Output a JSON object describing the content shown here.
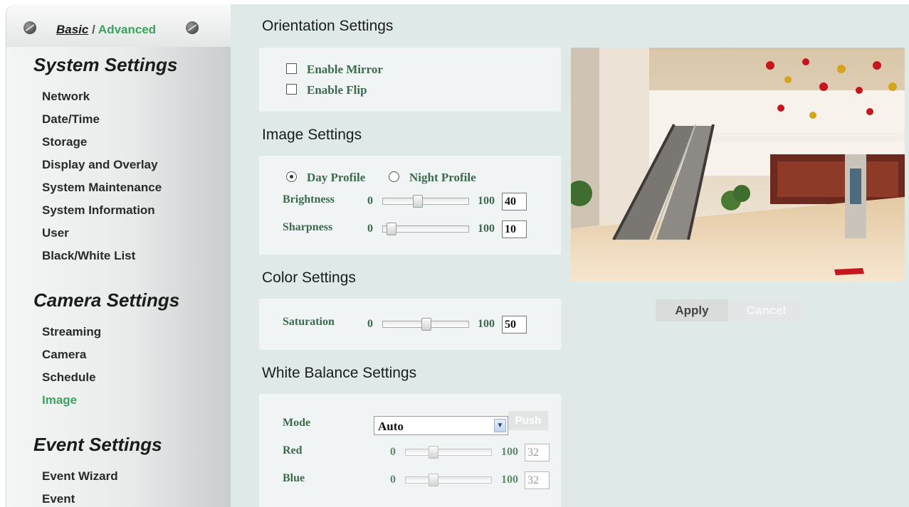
{
  "mode": {
    "basic": "Basic",
    "separator": " / ",
    "advanced": "Advanced"
  },
  "sidebar": {
    "system_title": "System Settings",
    "system_items": [
      "Network",
      "Date/Time",
      "Storage",
      "Display and Overlay",
      "System Maintenance",
      "System Information",
      "User",
      "Black/White List"
    ],
    "camera_title": "Camera Settings",
    "camera_items": [
      "Streaming",
      "Camera",
      "Schedule",
      "Image"
    ],
    "event_title": "Event Settings",
    "event_items": [
      "Event Wizard",
      "Event"
    ],
    "active_item": "Image"
  },
  "orientation": {
    "heading": "Orientation Settings",
    "mirror_label": "Enable Mirror",
    "mirror_checked": false,
    "flip_label": "Enable Flip",
    "flip_checked": false
  },
  "image": {
    "heading": "Image Settings",
    "day_profile_label": "Day Profile",
    "night_profile_label": "Night Profile",
    "selected_profile": "Day Profile",
    "brightness": {
      "label": "Brightness",
      "min": "0",
      "max": "100",
      "value": "40"
    },
    "sharpness": {
      "label": "Sharpness",
      "min": "0",
      "max": "100",
      "value": "10"
    }
  },
  "color": {
    "heading": "Color Settings",
    "saturation": {
      "label": "Saturation",
      "min": "0",
      "max": "100",
      "value": "50"
    }
  },
  "white_balance": {
    "heading": "White Balance Settings",
    "mode_label": "Mode",
    "mode_value": "Auto",
    "push_label": "Push",
    "red": {
      "label": "Red",
      "min": "0",
      "max": "100",
      "value": "32"
    },
    "blue": {
      "label": "Blue",
      "min": "0",
      "max": "100",
      "value": "32"
    }
  },
  "actions": {
    "apply": "Apply",
    "cancel": "Cancel"
  },
  "colors": {
    "accent_green": "#3aa35c",
    "label_green": "#3b6a4c",
    "main_bg": "#dee9e8",
    "panel_bg": "#f1f4f4"
  }
}
